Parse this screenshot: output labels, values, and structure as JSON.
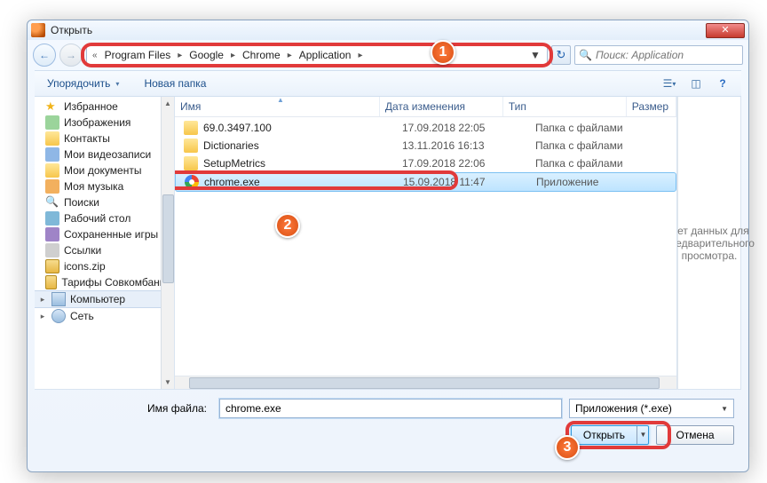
{
  "title": "Открыть",
  "breadcrumbs": [
    "Program Files",
    "Google",
    "Chrome",
    "Application"
  ],
  "search_placeholder": "Поиск: Application",
  "toolbar": {
    "organize": "Упорядочить",
    "newfolder": "Новая папка"
  },
  "nav": [
    {
      "l": 1,
      "t": "Избранное",
      "ic": "ic-star"
    },
    {
      "l": 1,
      "t": "Изображения",
      "ic": "ic-pic"
    },
    {
      "l": 1,
      "t": "Контакты",
      "ic": "ic-folder"
    },
    {
      "l": 1,
      "t": "Мои видеозаписи",
      "ic": "ic-vid"
    },
    {
      "l": 1,
      "t": "Мои документы",
      "ic": "ic-doc"
    },
    {
      "l": 1,
      "t": "Моя музыка",
      "ic": "ic-mus"
    },
    {
      "l": 1,
      "t": "Поиски",
      "ic": "ic-search"
    },
    {
      "l": 1,
      "t": "Рабочий стол",
      "ic": "ic-desk"
    },
    {
      "l": 1,
      "t": "Сохраненные игры",
      "ic": "ic-games"
    },
    {
      "l": 1,
      "t": "Ссылки",
      "ic": "ic-link"
    },
    {
      "l": 1,
      "t": "icons.zip",
      "ic": "ic-zip"
    },
    {
      "l": 1,
      "t": "Тарифы Совкомбанка",
      "ic": "ic-zip"
    },
    {
      "l": 0,
      "t": "Компьютер",
      "ic": "ic-pc",
      "comp": true
    },
    {
      "l": 0,
      "t": "Сеть",
      "ic": "ic-net"
    }
  ],
  "columns": {
    "name": "Имя",
    "date": "Дата изменения",
    "type": "Тип",
    "size": "Размер"
  },
  "rows": [
    {
      "name": "69.0.3497.100",
      "date": "17.09.2018 22:05",
      "type": "Папка с файлами",
      "ic": "folder"
    },
    {
      "name": "Dictionaries",
      "date": "13.11.2016 16:13",
      "type": "Папка с файлами",
      "ic": "folder"
    },
    {
      "name": "SetupMetrics",
      "date": "17.09.2018 22:06",
      "type": "Папка с файлами",
      "ic": "folder"
    },
    {
      "name": "chrome.exe",
      "date": "15.09.2018 11:47",
      "type": "Приложение",
      "ic": "exe",
      "sel": true
    }
  ],
  "preview_msg": "Нет данных для предварительного просмотра.",
  "filename_label": "Имя файла:",
  "filename_value": "chrome.exe",
  "filter": "Приложения (*.exe)",
  "buttons": {
    "open": "Открыть",
    "cancel": "Отмена"
  },
  "badges": [
    "1",
    "2",
    "3"
  ]
}
